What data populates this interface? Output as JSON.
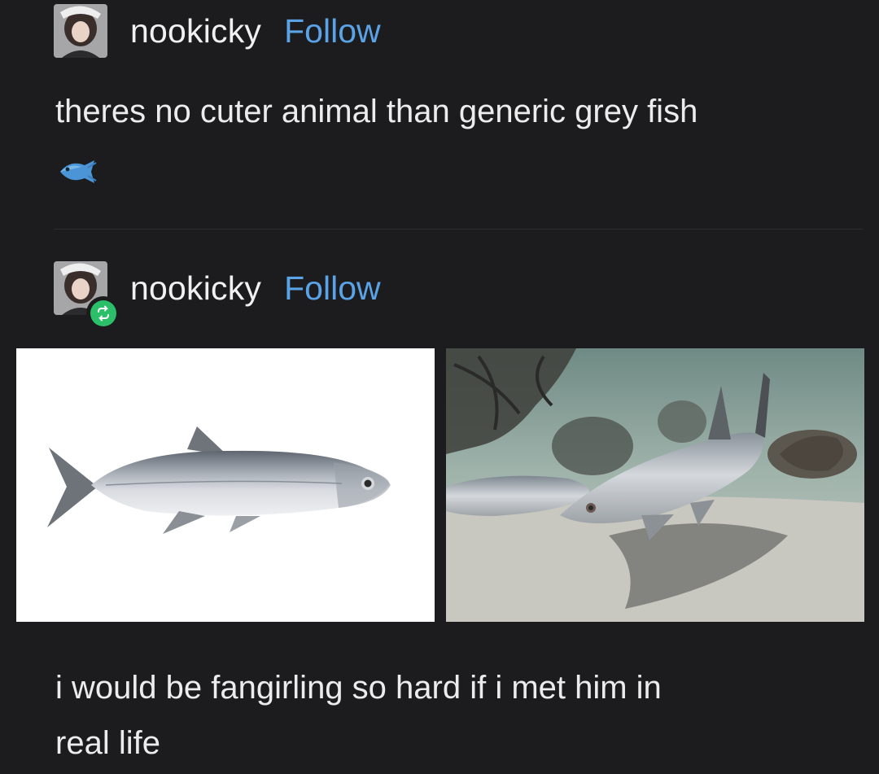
{
  "post1": {
    "username": "nookicky",
    "follow_label": "Follow",
    "text": "theres no cuter animal than generic grey fish",
    "emoji": "fish-emoji"
  },
  "post2": {
    "username": "nookicky",
    "follow_label": "Follow",
    "badge": "reblog-icon",
    "images": [
      "grey-fish-white-background",
      "fish-swimming-underwater"
    ],
    "text_line1": "i would be fangirling so hard if i met him in",
    "text_line2": "real life"
  },
  "colors": {
    "background": "#1c1c1e",
    "follow": "#5aa3e6",
    "reblog_badge": "#2cbf6a",
    "text": "#ececec"
  }
}
